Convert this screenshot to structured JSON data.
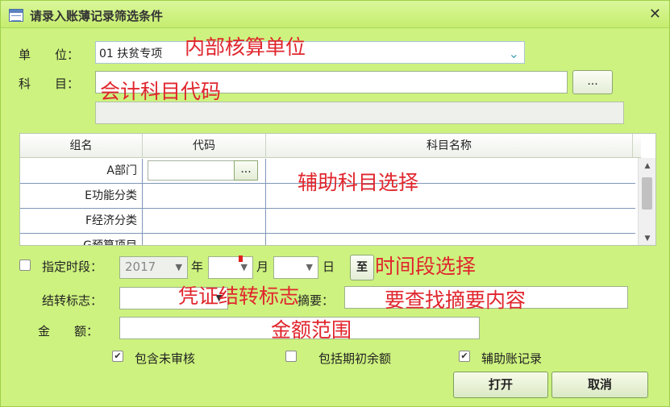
{
  "window": {
    "title": "请录入账薄记录筛选条件",
    "close": "✕"
  },
  "form": {
    "unit_label": "单　　位：",
    "unit_value": "01 扶贫专项",
    "subject_label": "科　　目：",
    "subject_value": "",
    "subject_browse": "...",
    "subject_desc": ""
  },
  "grid": {
    "headers": [
      "组名",
      "代码",
      "科目名称"
    ],
    "rows": [
      {
        "name": "A部门",
        "code": "",
        "has_browse": true,
        "browse": "..."
      },
      {
        "name": "E功能分类",
        "code": ""
      },
      {
        "name": "F经济分类",
        "code": ""
      },
      {
        "name": "G预算项目",
        "code": ""
      }
    ]
  },
  "period": {
    "label": "指定时段：",
    "year": "2017",
    "year_unit": "年",
    "month_unit": "月",
    "day_unit": "日",
    "to_button": "至"
  },
  "carry": {
    "label": "结转标志：",
    "value": ""
  },
  "summary": {
    "label": "摘要：",
    "value": ""
  },
  "amount": {
    "label": "金　　额：",
    "value": ""
  },
  "options": {
    "include_unaudited": "包含未审核",
    "include_opening": "包括期初余额",
    "aux_records": "辅助账记录",
    "checked_mark": "✔"
  },
  "buttons": {
    "open": "打开",
    "cancel": "取消"
  },
  "annotations": {
    "unit": "内部核算单位",
    "subject": "会计科目代码",
    "aux": "辅助科目选择",
    "period": "时间段选择",
    "carry": "凭证结转标志",
    "summary": "要查找摘要内容",
    "amount": "金额范围"
  }
}
